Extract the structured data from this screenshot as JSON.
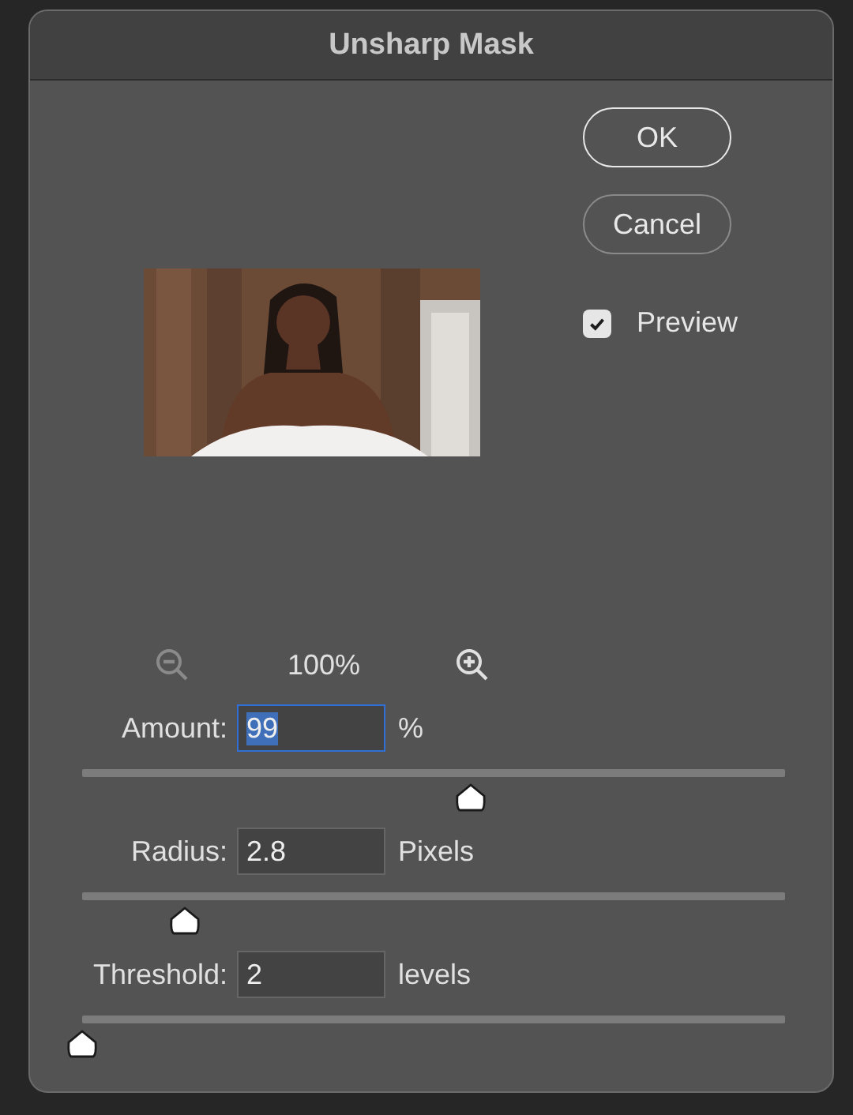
{
  "dialog": {
    "title": "Unsharp Mask"
  },
  "buttons": [
    {
      "label": "OK",
      "kind": "default"
    },
    {
      "label": "Cancel",
      "kind": "normal"
    }
  ],
  "preview": {
    "label": "Preview",
    "checked": true
  },
  "zoom": {
    "reading": "100%"
  },
  "controls": [
    {
      "label": "Amount:",
      "value": "99",
      "unit": "%",
      "focused": true,
      "level": 0.53
    },
    {
      "label": "Radius:",
      "value": "2.8",
      "unit": "Pixels",
      "focused": false,
      "level": 0.14
    },
    {
      "label": "Threshold:",
      "value": "2",
      "unit": "levels",
      "focused": false,
      "level": 0
    }
  ]
}
